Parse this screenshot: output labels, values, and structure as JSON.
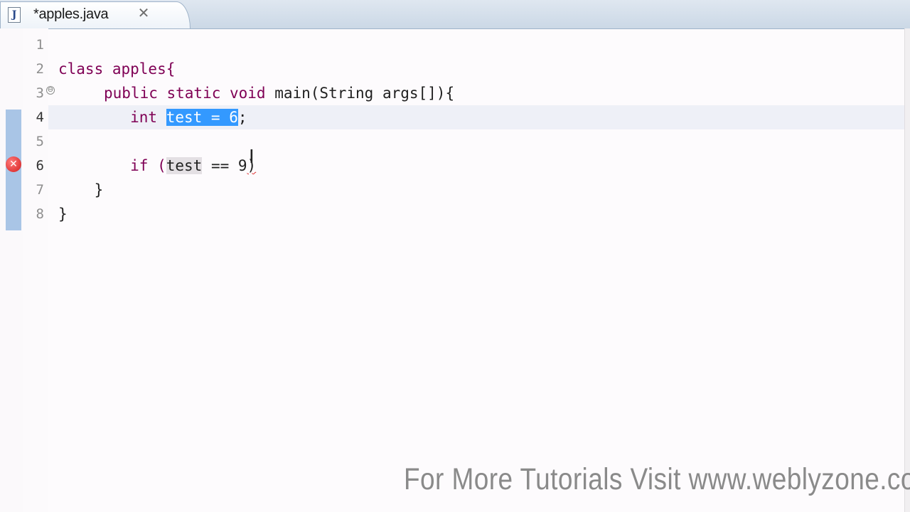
{
  "tab": {
    "title": "*apples.java",
    "close_glyph": "✕",
    "file_icon": "java-file-icon"
  },
  "gutter": {
    "line_numbers": [
      "1",
      "2",
      "3",
      "4",
      "5",
      "6",
      "7",
      "8"
    ],
    "current_line": "4",
    "error_line": "6",
    "fold_glyph": "⊖"
  },
  "code": {
    "line1": "",
    "line2": "class apples{",
    "line3_kw": "public static void",
    "line3_rest": " main(String args[]){",
    "line4_indent": "        int ",
    "line4_sel": "test = 6",
    "line4_end": ";",
    "line5": "",
    "line6_indent": "        if (",
    "line6_occ": "test",
    "line6_rest": " == 9",
    "line6_err": ")",
    "line7": "    }",
    "line8": "}"
  },
  "colors": {
    "keyword": "#7f0055",
    "selection": "#3399ff",
    "error": "#d41d1d"
  },
  "watermark": "For More Tutorials Visit www.weblyzone.com"
}
